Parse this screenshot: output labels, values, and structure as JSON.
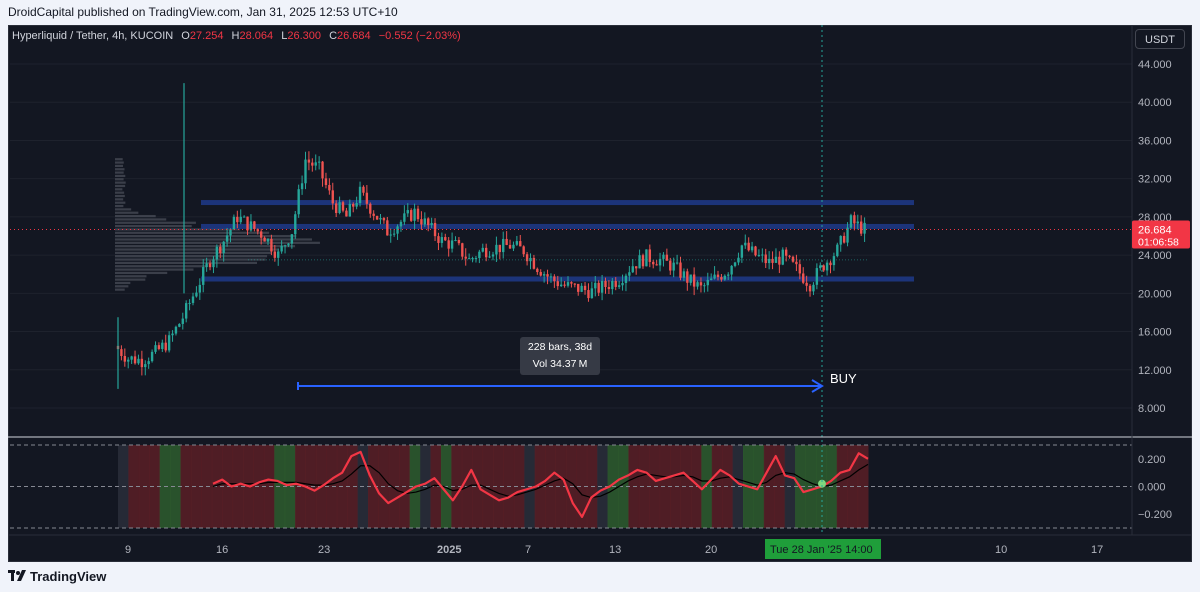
{
  "header": {
    "publish_text": "DroidCapital published on TradingView.com, Jan 31, 2025 12:53 UTC+10"
  },
  "symbol": {
    "name": "Hyperliquid / Tether, 4h, KUCOIN",
    "open_label": "O",
    "open": "27.254",
    "high_label": "H",
    "high": "28.064",
    "low_label": "L",
    "low": "26.300",
    "close_label": "C",
    "close": "26.684",
    "change": "−0.552 (−2.03%)"
  },
  "currency_button": "USDT",
  "price_axis": {
    "ticks": [
      "44.000",
      "40.000",
      "36.000",
      "32.000",
      "28.000",
      "24.000",
      "20.000",
      "16.000",
      "12.000",
      "8.000"
    ],
    "current_price": "26.684",
    "countdown": "01:06:58"
  },
  "oscillator_axis": {
    "ticks": [
      "0.200",
      "0.000",
      "−0.200"
    ]
  },
  "time_axis": {
    "ticks": [
      "9",
      "16",
      "23",
      "2025",
      "7",
      "13",
      "20",
      "10",
      "17"
    ],
    "highlight": "Tue 28 Jan '25   14:00"
  },
  "measure": {
    "line1": "228 bars, 38d",
    "line2": "Vol 34.37 M"
  },
  "annotation": {
    "buy": "BUY"
  },
  "footer": {
    "brand": "TradingView"
  },
  "colors": {
    "bull": "#26a69a",
    "bear": "#ef5350",
    "background": "#131722",
    "zone": "#1e3a8a",
    "arrow": "#2962ff",
    "price_tag": "#f23645",
    "osc_line": "#f23645",
    "highlight_green": "#1f9e3a"
  },
  "chart_data": {
    "type": "candlestick",
    "symbol": "Hyperliquid / Tether",
    "timeframe": "4h",
    "exchange": "KUCOIN",
    "ylim": [
      6,
      46
    ],
    "price_series": [
      {
        "date": "Dec 7",
        "price": 14.5
      },
      {
        "date": "Dec 8",
        "price": 13.2
      },
      {
        "date": "Dec 9",
        "price": 13.0
      },
      {
        "date": "Dec 10",
        "price": 13.8
      },
      {
        "date": "Dec 11",
        "price": 15.0
      },
      {
        "date": "Dec 12",
        "price": 17.5
      },
      {
        "date": "Dec 13",
        "price": 20.5
      },
      {
        "date": "Dec 14",
        "price": 23.5
      },
      {
        "date": "Dec 15",
        "price": 25.5
      },
      {
        "date": "Dec 16",
        "price": 28.0
      },
      {
        "date": "Dec 17",
        "price": 27.0
      },
      {
        "date": "Dec 18",
        "price": 26.0
      },
      {
        "date": "Dec 19",
        "price": 24.0
      },
      {
        "date": "Dec 20",
        "price": 26.5
      },
      {
        "date": "Dec 21",
        "price": 34.0
      },
      {
        "date": "Dec 22",
        "price": 33.0
      },
      {
        "date": "Dec 23",
        "price": 29.5
      },
      {
        "date": "Dec 24",
        "price": 28.0
      },
      {
        "date": "Dec 25",
        "price": 30.5
      },
      {
        "date": "Dec 26",
        "price": 28.5
      },
      {
        "date": "Dec 27",
        "price": 26.5
      },
      {
        "date": "Dec 28",
        "price": 27.5
      },
      {
        "date": "Dec 29",
        "price": 28.5
      },
      {
        "date": "Dec 30",
        "price": 27.0
      },
      {
        "date": "Dec 31",
        "price": 25.5
      },
      {
        "date": "Jan 1",
        "price": 25.0
      },
      {
        "date": "Jan 2",
        "price": 23.5
      },
      {
        "date": "Jan 3",
        "price": 24.5
      },
      {
        "date": "Jan 4",
        "price": 24.8
      },
      {
        "date": "Jan 5",
        "price": 25.0
      },
      {
        "date": "Jan 6",
        "price": 24.5
      },
      {
        "date": "Jan 7",
        "price": 22.8
      },
      {
        "date": "Jan 8",
        "price": 21.5
      },
      {
        "date": "Jan 9",
        "price": 20.8
      },
      {
        "date": "Jan 10",
        "price": 20.5
      },
      {
        "date": "Jan 11",
        "price": 20.2
      },
      {
        "date": "Jan 12",
        "price": 20.8
      },
      {
        "date": "Jan 13",
        "price": 21.5
      },
      {
        "date": "Jan 14",
        "price": 23.0
      },
      {
        "date": "Jan 15",
        "price": 23.8
      },
      {
        "date": "Jan 16",
        "price": 23.5
      },
      {
        "date": "Jan 17",
        "price": 22.8
      },
      {
        "date": "Jan 18",
        "price": 21.5
      },
      {
        "date": "Jan 19",
        "price": 20.5
      },
      {
        "date": "Jan 20",
        "price": 21.5
      },
      {
        "date": "Jan 21",
        "price": 22.5
      },
      {
        "date": "Jan 22",
        "price": 25.0
      },
      {
        "date": "Jan 23",
        "price": 24.0
      },
      {
        "date": "Jan 24",
        "price": 23.2
      },
      {
        "date": "Jan 25",
        "price": 23.8
      },
      {
        "date": "Jan 26",
        "price": 22.5
      },
      {
        "date": "Jan 27",
        "price": 21.0
      },
      {
        "date": "Jan 28",
        "price": 23.0
      },
      {
        "date": "Jan 29",
        "price": 24.5
      },
      {
        "date": "Jan 30",
        "price": 27.5
      },
      {
        "date": "Jan 31",
        "price": 26.684
      }
    ],
    "oscillator": {
      "ylim": [
        -0.3,
        0.3
      ],
      "values": [
        0.02,
        0.05,
        0.0,
        0.02,
        0.0,
        0.03,
        0.05,
        0.04,
        0.01,
        0.02,
        0.0,
        -0.03,
        0.01,
        0.06,
        0.1,
        0.22,
        0.25,
        0.08,
        -0.05,
        -0.12,
        -0.08,
        -0.04,
        0.0,
        0.02,
        0.06,
        -0.02,
        -0.1,
        0.0,
        0.12,
        -0.02,
        -0.06,
        -0.1,
        -0.08,
        -0.04,
        -0.02,
        0.0,
        0.04,
        0.1,
        0.05,
        -0.12,
        -0.22,
        -0.08,
        -0.03,
        0.0,
        0.05,
        0.08,
        0.12,
        0.1,
        0.04,
        0.06,
        0.08,
        0.1,
        0.04,
        -0.02,
        0.05,
        0.12,
        0.08,
        0.02,
        0.0,
        -0.02,
        0.1,
        0.22,
        0.08,
        0.06,
        -0.04,
        -0.02,
        0.0,
        0.04,
        0.1,
        0.12,
        0.24,
        0.2
      ],
      "signal_values": [
        0.0,
        0.02,
        0.02,
        0.02,
        0.02,
        0.02,
        0.03,
        0.03,
        0.03,
        0.03,
        0.02,
        0.01,
        0.01,
        0.02,
        0.04,
        0.09,
        0.15,
        0.15,
        0.1,
        0.02,
        -0.03,
        -0.05,
        -0.04,
        -0.02,
        0.01,
        0.0,
        -0.03,
        -0.02,
        0.01,
        0.01,
        -0.02,
        -0.05,
        -0.07,
        -0.06,
        -0.04,
        -0.02,
        0.01,
        0.04,
        0.06,
        0.02,
        -0.06,
        -0.08,
        -0.07,
        -0.04,
        0.0,
        0.04,
        0.07,
        0.09,
        0.08,
        0.07,
        0.07,
        0.08,
        0.07,
        0.04,
        0.04,
        0.06,
        0.07,
        0.05,
        0.03,
        0.01,
        0.03,
        0.08,
        0.1,
        0.09,
        0.05,
        0.02,
        0.0,
        0.01,
        0.04,
        0.07,
        0.12,
        0.16
      ],
      "zones": [
        "neutral",
        "bear",
        "bear",
        "bear",
        "bull",
        "bull",
        "bear",
        "bear",
        "bear",
        "bear",
        "bear",
        "bear",
        "bear",
        "bear",
        "bear",
        "bull",
        "bull",
        "bear",
        "bear",
        "bear",
        "bear",
        "bear",
        "bear",
        "neutral",
        "bear",
        "bear",
        "bear",
        "bear",
        "bull",
        "neutral",
        "bear",
        "bull",
        "bear",
        "bear",
        "bear",
        "bear",
        "bear",
        "bear",
        "bear",
        "neutral",
        "bear",
        "bear",
        "bear",
        "bear",
        "bear",
        "bear",
        "neutral",
        "bull",
        "bull",
        "bear",
        "bear",
        "bear",
        "bear",
        "bear",
        "bear",
        "bear",
        "bull",
        "bear",
        "bear",
        "neutral",
        "bull",
        "bull",
        "bear",
        "bear",
        "neutral",
        "bull",
        "bull",
        "bull",
        "bull",
        "bear",
        "bear",
        "bear"
      ]
    },
    "levels": [
      29.5,
      27.0,
      21.5
    ],
    "buy_signal": {
      "date": "Jan 28",
      "label": "BUY"
    }
  }
}
